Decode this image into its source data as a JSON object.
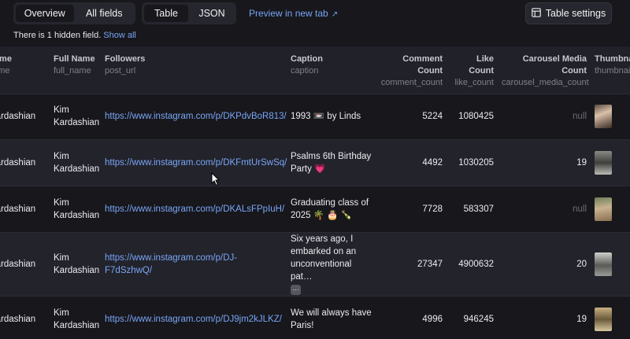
{
  "toolbar": {
    "view_tabs": [
      "Overview",
      "All fields"
    ],
    "format_tabs": [
      "Table",
      "JSON"
    ],
    "preview_label": "Preview in new tab",
    "preview_arrow": "↗",
    "table_settings_label": "Table settings"
  },
  "hidden_note": {
    "text": "There is 1 hidden field.",
    "link": "Show all"
  },
  "columns": [
    {
      "title": "Name",
      "key": "name"
    },
    {
      "title": "Full Name",
      "key": "full_name"
    },
    {
      "title": "Followers",
      "key": "post_url"
    },
    {
      "title": "Caption",
      "key": "caption"
    },
    {
      "title": "Comment Count",
      "key": "comment_count"
    },
    {
      "title": "Like Count",
      "key": "like_count"
    },
    {
      "title": "Carousel Media Count",
      "key": "carousel_media_count"
    },
    {
      "title": "Thumbnail",
      "key": "thumbnail"
    }
  ],
  "rows": [
    {
      "name": "Kardashian",
      "full_name": "Kim Kardashian",
      "post_url": "https://www.instagram.com/p/DKPdvBoR813/",
      "caption": "1993 📼 by Linds",
      "comment_count": "5224",
      "like_count": "1080425",
      "carousel": "null"
    },
    {
      "name": "Kardashian",
      "full_name": "Kim Kardashian",
      "post_url": "https://www.instagram.com/p/DKFmtUrSwSq/",
      "caption": "Psalms 6th Birthday Party 💗",
      "comment_count": "4492",
      "like_count": "1030205",
      "carousel": "19"
    },
    {
      "name": "Kardashian",
      "full_name": "Kim Kardashian",
      "post_url": "https://www.instagram.com/p/DKALsFPpIuH/",
      "caption": "Graduating class of 2025 🌴 🎂 🍾",
      "comment_count": "7728",
      "like_count": "583307",
      "carousel": "null"
    },
    {
      "name": "Kardashian",
      "full_name": "Kim Kardashian",
      "post_url": "https://www.instagram.com/p/DJ-F7dSzhwQ/",
      "caption": "Six years ago, I embarked on an unconventional pat…",
      "comment_count": "27347",
      "like_count": "4900632",
      "carousel": "20"
    },
    {
      "name": "Kardashian",
      "full_name": "Kim Kardashian",
      "post_url": "https://www.instagram.com/p/DJ9jm2kJLKZ/",
      "caption": "We will always have Paris!",
      "comment_count": "4996",
      "like_count": "946245",
      "carousel": "19"
    }
  ],
  "more_glyph": "⋯",
  "icons": {
    "table_settings": "table-icon",
    "thumbnails": "photo-thumbnail"
  }
}
